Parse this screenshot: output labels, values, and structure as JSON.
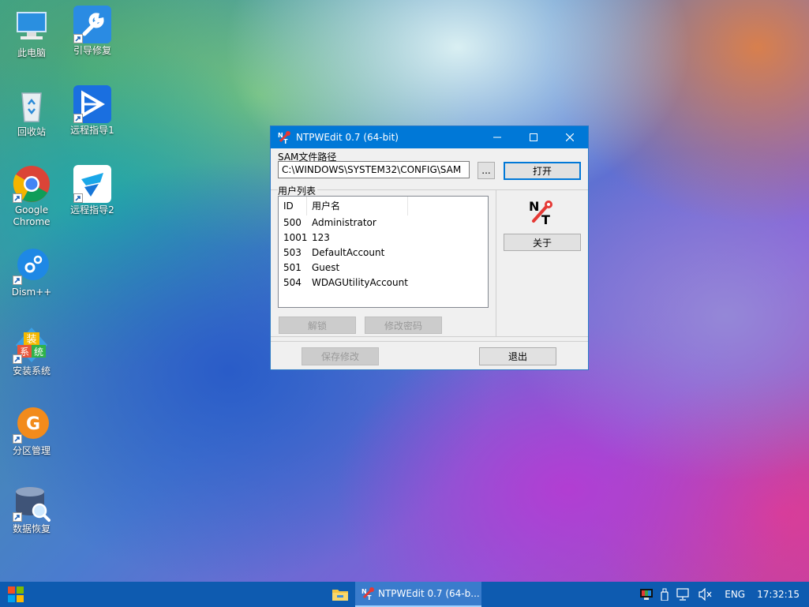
{
  "desktop": {
    "icons": [
      {
        "label": "此电脑",
        "icon": "computer-icon"
      },
      {
        "label": "引导修复",
        "icon": "wrench-icon"
      },
      {
        "label": "回收站",
        "icon": "recycle-bin-icon"
      },
      {
        "label": "远程指导1",
        "icon": "remote-assist-icon"
      },
      {
        "label": "Google Chrome",
        "icon": "chrome-icon"
      },
      {
        "label": "远程指导2",
        "icon": "remote-assist-2-icon"
      },
      {
        "label": "Dism++",
        "icon": "dism-gear-icon"
      },
      {
        "label": "安装系统",
        "icon": "install-system-icon"
      },
      {
        "label": "分区管理",
        "icon": "partition-manager-icon"
      },
      {
        "label": "数据恢复",
        "icon": "data-recovery-icon"
      }
    ]
  },
  "window": {
    "title": "NTPWEdit 0.7 (64-bit)",
    "sam_group_label": "SAM文件路径",
    "sam_path_value": "C:\\WINDOWS\\SYSTEM32\\CONFIG\\SAM",
    "browse_label": "...",
    "open_label": "打开",
    "users_group_label": "用户列表",
    "columns": [
      "ID",
      "用户名"
    ],
    "users": [
      {
        "id": "500",
        "name": "Administrator"
      },
      {
        "id": "1001",
        "name": "123"
      },
      {
        "id": "503",
        "name": "DefaultAccount"
      },
      {
        "id": "501",
        "name": "Guest"
      },
      {
        "id": "504",
        "name": "WDAGUtilityAccount"
      }
    ],
    "unlock_label": "解锁",
    "change_password_label": "修改密码",
    "about_label": "关于",
    "save_label": "保存修改",
    "exit_label": "退出",
    "logo_text": "NT"
  },
  "taskbar": {
    "task_title": "NTPWEdit 0.7 (64-b...",
    "language": "ENG",
    "time": "17:32:15"
  },
  "colors": {
    "titlebar": "#0078d7",
    "taskbar": "#0e5bb0"
  }
}
